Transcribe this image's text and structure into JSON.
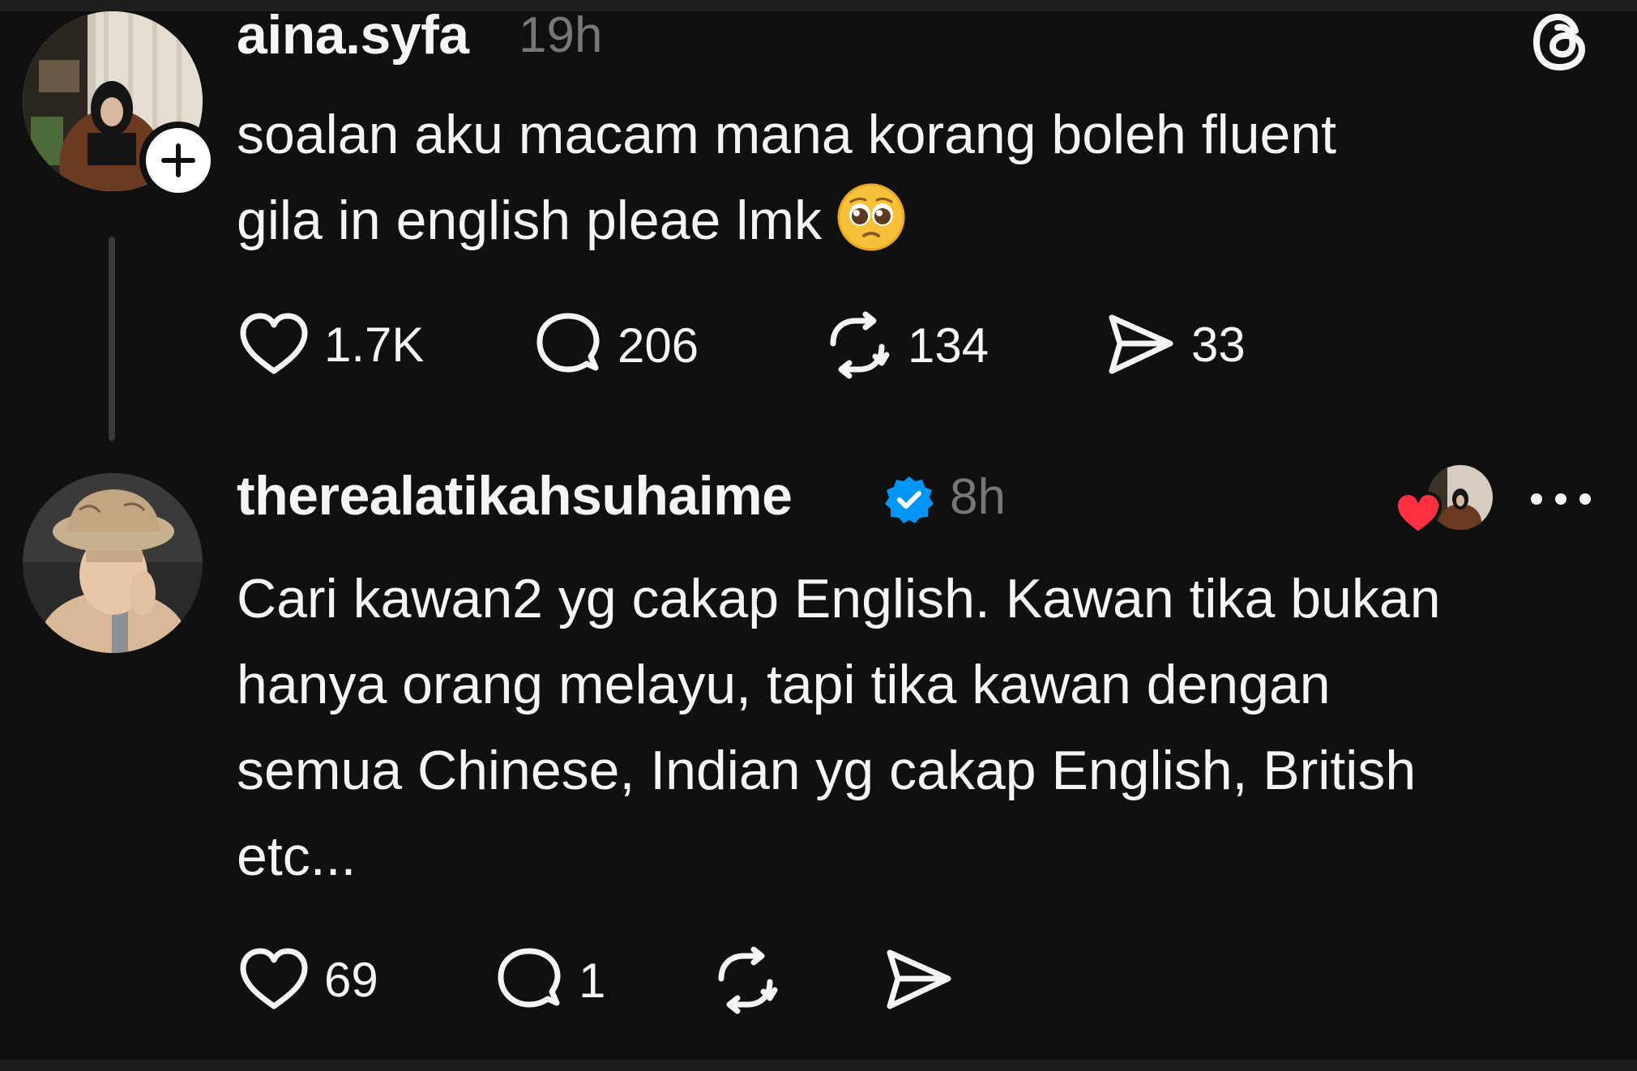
{
  "post": {
    "username": "aina.syfa",
    "time": "19h",
    "text_line1": "soalan aku macam mana korang boleh fluent",
    "text_line2": "gila in english pleae lmk",
    "emoji": "pleading-face-emoji",
    "likes": "1.7K",
    "comments": "206",
    "reposts": "134",
    "shares": "33"
  },
  "reply": {
    "username": "therealatikahsuhaime",
    "verified": true,
    "time": "8h",
    "text_lines": [
      "Cari kawan2 yg cakap English. Kawan tika bukan",
      "hanya orang melayu, tapi tika kawan dengan",
      "semua Chinese, Indian yg cakap English, British",
      "etc..."
    ],
    "likes": "69",
    "comments": "1"
  },
  "icons": {
    "threads_logo": "threads-logo-icon",
    "heart": "heart-icon",
    "comment": "comment-icon",
    "repost": "repost-icon",
    "share": "send-icon",
    "more": "more-options-icon",
    "verified": "verified-badge-icon",
    "follow": "plus-icon"
  },
  "colors": {
    "background": "#101010",
    "text": "#f3f5f7",
    "muted": "#777777",
    "verified": "#0095f6",
    "liked_heart": "#ff3040"
  }
}
